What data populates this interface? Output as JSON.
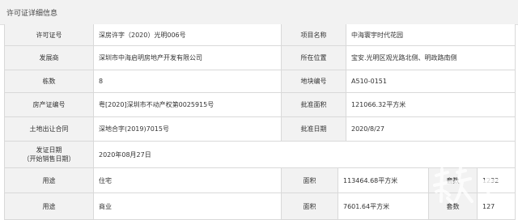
{
  "header": {
    "title": "许可证详细信息"
  },
  "rows": [
    {
      "l1": "许可证号",
      "v1": "深房许字（2020）光明006号",
      "l2": "项目名称",
      "v2": "中海寰宇时代花园"
    },
    {
      "l1": "发展商",
      "v1": "深圳市中海启明房地产开发有限公司",
      "l2": "所在位置",
      "v2": "宝安.光明区观光路北侧、明政路南侧"
    },
    {
      "l1": "栋数",
      "v1": "8",
      "l2": "地块编号",
      "v2": "A510-0151"
    },
    {
      "l1": "房产证编号",
      "v1": "粤[2020]深圳市不动产权第0025915号",
      "l2": "批准面积",
      "v2": "121066.32平方米"
    },
    {
      "l1": "土地出让合同",
      "v1": "深地合字(2019)7015号",
      "l2": "批准日期",
      "v2": "2020/8/27"
    }
  ],
  "issue": {
    "label_line1": "发证日期",
    "label_line2": "（开始销售日期）",
    "value": "2020年08月27日"
  },
  "usage_rows": [
    {
      "label": "用途",
      "use": "住宅",
      "area_label": "面积",
      "area": "113464.68平方米",
      "units_label": "套数",
      "units": "1232"
    },
    {
      "label": "用途",
      "use": "商业",
      "area_label": "面积",
      "area": "7601.64平方米",
      "units_label": "套数",
      "units": "127"
    }
  ],
  "watermark": {
    "text": "南方+"
  }
}
